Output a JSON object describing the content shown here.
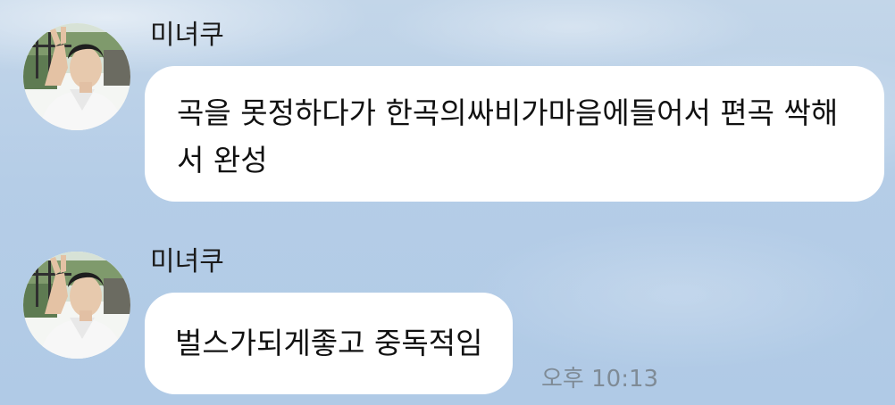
{
  "conversation": {
    "messages": [
      {
        "sender": "미녀쿠",
        "text": "곡을 못정하다가 한곡의싸비가마음에들어서 편곡 싹해서 완성"
      },
      {
        "sender": "미녀쿠",
        "text": "벌스가되게좋고 중독적임",
        "time": "오후 10:13"
      }
    ]
  },
  "colors": {
    "background": "#b5cde7",
    "bubble": "#ffffff",
    "text": "#111111",
    "timestamp": "#7f8b96"
  },
  "icons": {
    "avatar": "profile-photo"
  }
}
